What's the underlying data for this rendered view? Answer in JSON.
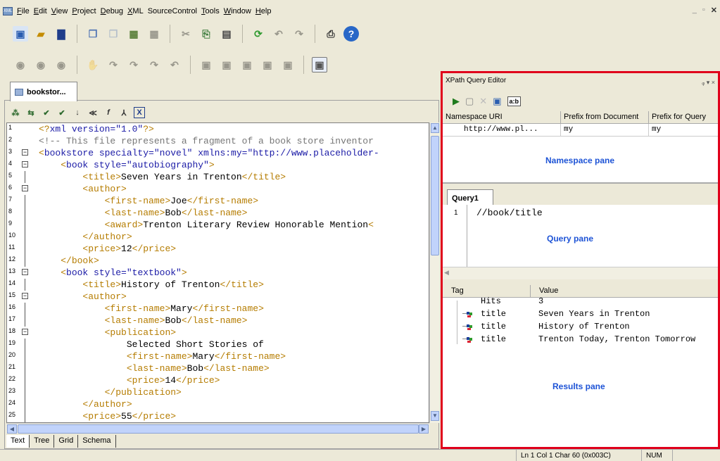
{
  "menu": {
    "items": [
      {
        "label": "File",
        "u": "F",
        "rest": "ile"
      },
      {
        "label": "Edit",
        "u": "E",
        "rest": "dit"
      },
      {
        "label": "View",
        "u": "V",
        "rest": "iew"
      },
      {
        "label": "Project",
        "u": "P",
        "rest": "roject"
      },
      {
        "label": "Debug",
        "u": "D",
        "rest": "ebug"
      },
      {
        "label": "XML",
        "u": "X",
        "rest": "ML"
      },
      {
        "label": "SourceControl",
        "u": "",
        "rest": "SourceControl"
      },
      {
        "label": "Tools",
        "u": "T",
        "rest": "ools"
      },
      {
        "label": "Window",
        "u": "W",
        "rest": "indow"
      },
      {
        "label": "Help",
        "u": "H",
        "rest": "elp"
      }
    ],
    "app_icon": "XML"
  },
  "editor": {
    "tab_label": "bookstor...",
    "view_tabs": [
      "Text",
      "Tree",
      "Grid",
      "Schema"
    ],
    "lines": [
      {
        "n": "1",
        "html": "<span class='tg'>&lt;?</span><span class='at'>xml version=\"1.0\"</span><span class='tg'>?&gt;</span>"
      },
      {
        "n": "2",
        "html": "<span class='cm'>&lt;!-- This file represents a fragment of a book store inventor</span>"
      },
      {
        "n": "3",
        "html": "<span class='tg'>&lt;</span><span class='at'>bookstore specialty=\"novel\" xmlns:my=\"http://www.placeholder-</span>"
      },
      {
        "n": "4",
        "html": "    <span class='tg'>&lt;</span><span class='at'>book style=\"autobiography\"</span><span class='tg'>&gt;</span>"
      },
      {
        "n": "5",
        "html": "        <span class='tg'>&lt;title&gt;</span>Seven Years in Trenton<span class='tg'>&lt;/title&gt;</span>"
      },
      {
        "n": "6",
        "html": "        <span class='tg'>&lt;author&gt;</span>"
      },
      {
        "n": "7",
        "html": "            <span class='tg'>&lt;first-name&gt;</span>Joe<span class='tg'>&lt;/first-name&gt;</span>"
      },
      {
        "n": "8",
        "html": "            <span class='tg'>&lt;last-name&gt;</span>Bob<span class='tg'>&lt;/last-name&gt;</span>"
      },
      {
        "n": "9",
        "html": "            <span class='tg'>&lt;award&gt;</span>Trenton Literary Review Honorable Mention<span class='tg'>&lt;</span>"
      },
      {
        "n": "10",
        "html": "        <span class='tg'>&lt;/author&gt;</span>"
      },
      {
        "n": "11",
        "html": "        <span class='tg'>&lt;price&gt;</span>12<span class='tg'>&lt;/price&gt;</span>"
      },
      {
        "n": "12",
        "html": "    <span class='tg'>&lt;/book&gt;</span>"
      },
      {
        "n": "13",
        "html": "    <span class='tg'>&lt;</span><span class='at'>book style=\"textbook\"</span><span class='tg'>&gt;</span>"
      },
      {
        "n": "14",
        "html": "        <span class='tg'>&lt;title&gt;</span>History of Trenton<span class='tg'>&lt;/title&gt;</span>"
      },
      {
        "n": "15",
        "html": "        <span class='tg'>&lt;author&gt;</span>"
      },
      {
        "n": "16",
        "html": "            <span class='tg'>&lt;first-name&gt;</span>Mary<span class='tg'>&lt;/first-name&gt;</span>"
      },
      {
        "n": "17",
        "html": "            <span class='tg'>&lt;last-name&gt;</span>Bob<span class='tg'>&lt;/last-name&gt;</span>"
      },
      {
        "n": "18",
        "html": "            <span class='tg'>&lt;publication&gt;</span>"
      },
      {
        "n": "19",
        "html": "                Selected Short Stories of"
      },
      {
        "n": "20",
        "html": "                <span class='tg'>&lt;first-name&gt;</span>Mary<span class='tg'>&lt;/first-name&gt;</span>"
      },
      {
        "n": "21",
        "html": "                <span class='tg'>&lt;last-name&gt;</span>Bob<span class='tg'>&lt;/last-name&gt;</span>"
      },
      {
        "n": "22",
        "html": "                <span class='tg'>&lt;price&gt;</span>14<span class='tg'>&lt;/price&gt;</span>"
      },
      {
        "n": "23",
        "html": "            <span class='tg'>&lt;/publication&gt;</span>"
      },
      {
        "n": "24",
        "html": "        <span class='tg'>&lt;/author&gt;</span>"
      },
      {
        "n": "25",
        "html": "        <span class='tg'>&lt;price&gt;</span>55<span class='tg'>&lt;/price&gt;</span>"
      }
    ]
  },
  "xpath": {
    "title": "XPath Query Editor",
    "title_controls": "ᵩ ▾ ×",
    "ns_headers": [
      "Namespace URI",
      "Prefix from Document",
      "Prefix for Query"
    ],
    "ns_row": [
      "http://www.pl...",
      "my",
      "my"
    ],
    "namespace_pane_label": "Namespace pane",
    "query_tab": "Query1",
    "query_line_no": "1",
    "query_text": "//book/title",
    "query_pane_label": "Query pane",
    "results_headers": [
      "Tag",
      "Value"
    ],
    "hits_label": "Hits",
    "hits_value": "3",
    "results": [
      {
        "tag": "title",
        "value": "Seven Years in Trenton"
      },
      {
        "tag": "title",
        "value": "History of Trenton"
      },
      {
        "tag": "title",
        "value": "Trenton Today, Trenton Tomorrow"
      }
    ],
    "results_pane_label": "Results pane",
    "ab_button": "a:b"
  },
  "status": {
    "position": "Ln 1 Col 1  Char 60 (0x003C)",
    "num": "NUM"
  },
  "colors": {
    "highlight_border": "#e0001b",
    "pane_label": "#1d53d6",
    "tag": "#b57c00",
    "attr": "#1a1aa6"
  }
}
